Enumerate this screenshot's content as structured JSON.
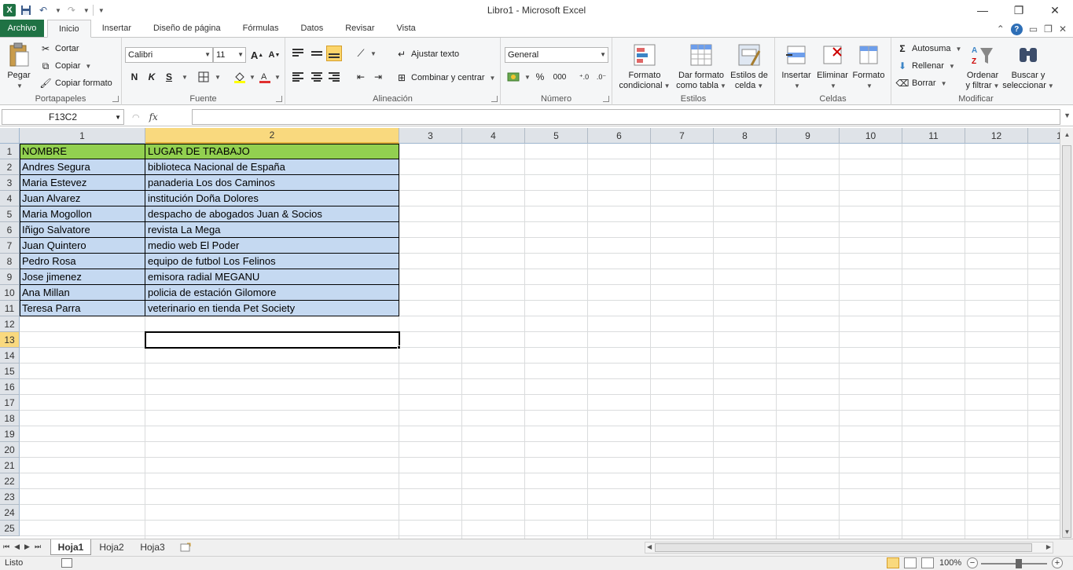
{
  "window": {
    "title": "Libro1  -  Microsoft Excel",
    "controls": [
      "minimize-icon",
      "restore-icon",
      "close-icon"
    ]
  },
  "tabs": {
    "file": "Archivo",
    "items": [
      "Inicio",
      "Insertar",
      "Diseño de página",
      "Fórmulas",
      "Datos",
      "Revisar",
      "Vista"
    ],
    "active": "Inicio"
  },
  "ribbon": {
    "clipboard": {
      "label": "Portapapeles",
      "paste": "Pegar",
      "cut": "Cortar",
      "copy": "Copiar",
      "format_painter": "Copiar formato"
    },
    "font": {
      "label": "Fuente",
      "name": "Calibri",
      "size": "11",
      "bold": "N",
      "italic": "K",
      "underline": "S"
    },
    "alignment": {
      "label": "Alineación",
      "wrap": "Ajustar texto",
      "merge": "Combinar y centrar"
    },
    "number": {
      "label": "Número",
      "format": "General",
      "percent": "%",
      "thousands": "000"
    },
    "styles": {
      "label": "Estilos",
      "conditional": [
        "Formato",
        "condicional"
      ],
      "as_table": [
        "Dar formato",
        "como tabla"
      ],
      "cell_styles": [
        "Estilos de",
        "celda"
      ]
    },
    "cells": {
      "label": "Celdas",
      "insert": "Insertar",
      "delete": "Eliminar",
      "format": "Formato"
    },
    "editing": {
      "label": "Modificar",
      "autosum": "Autosuma",
      "fill": "Rellenar",
      "clear": "Borrar",
      "sort": [
        "Ordenar",
        "y filtrar"
      ],
      "find": [
        "Buscar y",
        "seleccionar"
      ]
    }
  },
  "formula_bar": {
    "name_box": "F13C2",
    "fx": "fx",
    "value": ""
  },
  "sheet": {
    "column_headers": [
      "1",
      "2",
      "3",
      "4",
      "5",
      "6",
      "7",
      "8",
      "9",
      "10",
      "11",
      "12",
      "1"
    ],
    "row_headers": [
      "1",
      "2",
      "3",
      "4",
      "5",
      "6",
      "7",
      "8",
      "9",
      "10",
      "11",
      "12",
      "13",
      "14",
      "15",
      "16",
      "17",
      "18",
      "19",
      "20",
      "21",
      "22",
      "23",
      "24",
      "25"
    ],
    "selected_column": "2",
    "selected_row": "13",
    "table": [
      [
        "NOMBRE",
        "LUGAR DE TRABAJO"
      ],
      [
        "Andres Segura",
        "biblioteca Nacional de España"
      ],
      [
        "Maria Estevez",
        "panaderia Los dos Caminos"
      ],
      [
        "Juan Alvarez",
        "institución Doña Dolores"
      ],
      [
        "Maria Mogollon",
        "despacho de abogados Juan & Socios"
      ],
      [
        "Iñigo Salvatore",
        "revista La Mega"
      ],
      [
        "Juan Quintero",
        "medio web El Poder"
      ],
      [
        "Pedro Rosa",
        "equipo de futbol Los Felinos"
      ],
      [
        "Jose jimenez",
        "emisora radial MEGANU"
      ],
      [
        "Ana Millan",
        "policia de estación Gilomore"
      ],
      [
        "Teresa Parra",
        "veterinario en tienda Pet Society"
      ]
    ],
    "colors": {
      "header_fill": "#92d050",
      "body_fill": "#c5d9f1",
      "excel_green": "#1f7244"
    }
  },
  "sheet_tabs": [
    "Hoja1",
    "Hoja2",
    "Hoja3"
  ],
  "active_sheet": "Hoja1",
  "status": {
    "text": "Listo",
    "zoom": "100%"
  }
}
